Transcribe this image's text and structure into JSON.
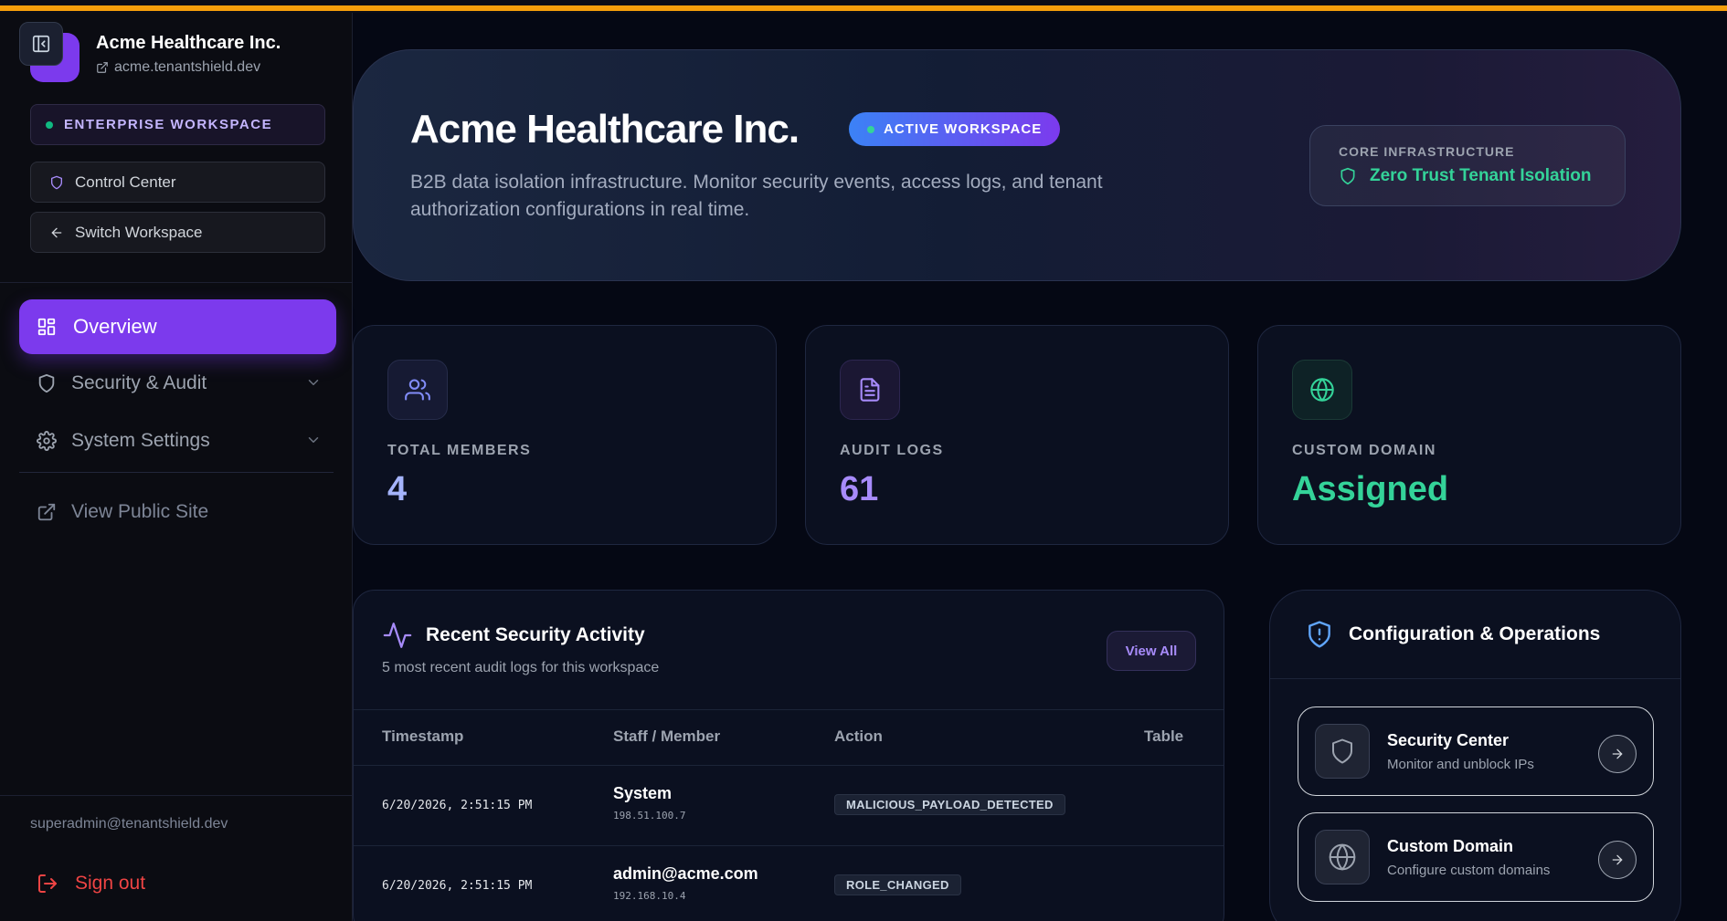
{
  "sidebar": {
    "workspace_name": "Acme Healthcare Inc.",
    "workspace_domain": "acme.tenantshield.dev",
    "plan_badge": "ENTERPRISE WORKSPACE",
    "control_center": "Control Center",
    "switch_workspace": "Switch Workspace",
    "nav": {
      "overview": "Overview",
      "security_audit": "Security & Audit",
      "system_settings": "System Settings",
      "view_public_site": "View Public Site"
    },
    "user_email": "superadmin@tenantshield.dev",
    "sign_out": "Sign out"
  },
  "hero": {
    "title": "Acme Healthcare Inc.",
    "badge": "ACTIVE WORKSPACE",
    "description": "B2B data isolation infrastructure. Monitor security events, access logs, and tenant authorization configurations in real time.",
    "infra_label": "CORE INFRASTRUCTURE",
    "infra_value": "Zero Trust Tenant Isolation"
  },
  "stats": [
    {
      "label": "TOTAL MEMBERS",
      "value": "4",
      "icon": "users-icon",
      "color": "#a5b4fc"
    },
    {
      "label": "AUDIT LOGS",
      "value": "61",
      "icon": "document-icon",
      "color": "#a78bfa"
    },
    {
      "label": "CUSTOM DOMAIN",
      "value": "Assigned",
      "icon": "globe-icon",
      "color": "#34d399"
    }
  ],
  "activity": {
    "title": "Recent Security Activity",
    "subtitle": "5 most recent audit logs for this workspace",
    "view_all": "View All",
    "columns": [
      "Timestamp",
      "Staff / Member",
      "Action",
      "Table"
    ],
    "rows": [
      {
        "timestamp": "6/20/2026, 2:51:15 PM",
        "member": "System",
        "ip": "198.51.100.7",
        "action": "MALICIOUS_PAYLOAD_DETECTED",
        "table": ""
      },
      {
        "timestamp": "6/20/2026, 2:51:15 PM",
        "member": "admin@acme.com",
        "ip": "192.168.10.4",
        "action": "ROLE_CHANGED",
        "table": ""
      }
    ]
  },
  "config": {
    "title": "Configuration & Operations",
    "items": [
      {
        "title": "Security Center",
        "subtitle": "Monitor and unblock IPs",
        "icon": "shield-icon"
      },
      {
        "title": "Custom Domain",
        "subtitle": "Configure custom domains",
        "icon": "globe-icon"
      }
    ]
  },
  "colors": {
    "accent": "#7c3aed",
    "top_stripe": "#f59e0b",
    "success": "#34d399",
    "danger": "#ef4444"
  }
}
